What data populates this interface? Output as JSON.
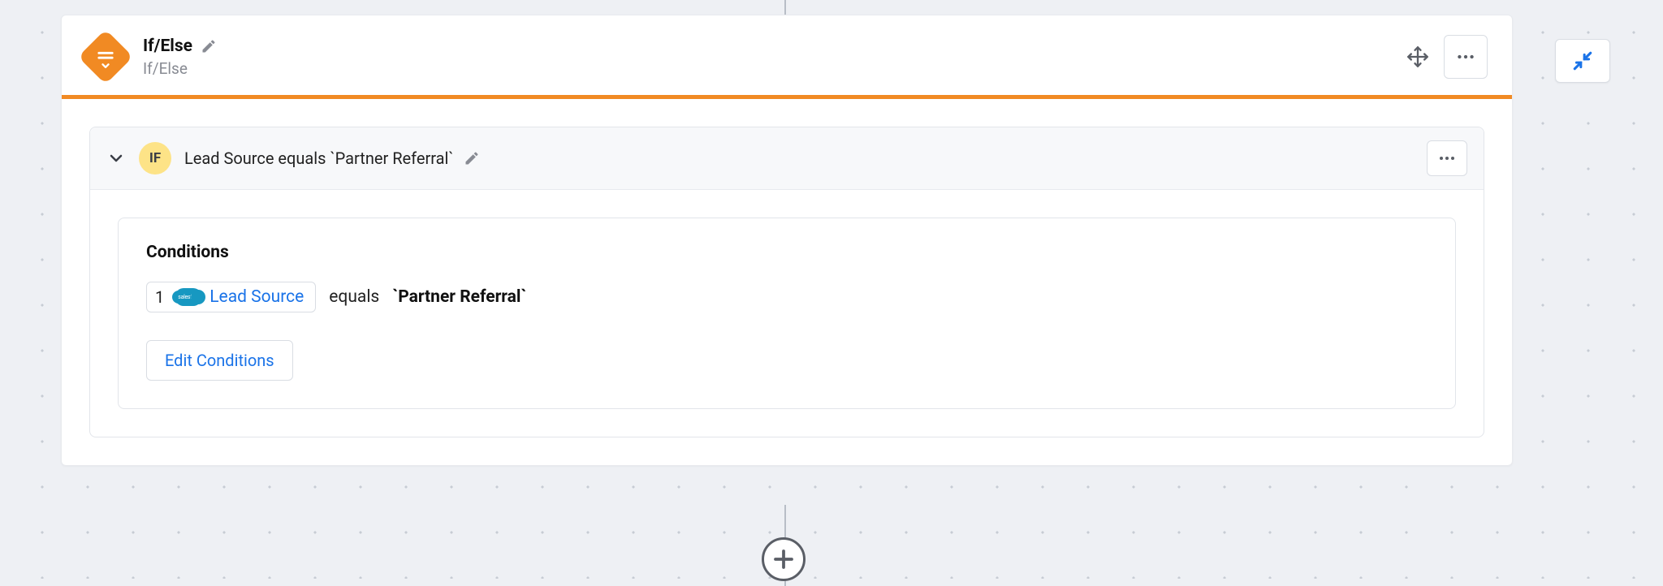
{
  "step": {
    "title": "If/Else",
    "subtitle": "If/Else",
    "iconName": "branch-icon"
  },
  "branch": {
    "badge": "IF",
    "title": "Lead Source equals `Partner Referral`"
  },
  "conditions": {
    "heading": "Conditions",
    "row": {
      "index": "1",
      "field": "Lead Source",
      "operator": "equals",
      "value": "`Partner Referral`"
    },
    "editLabel": "Edit Conditions"
  }
}
